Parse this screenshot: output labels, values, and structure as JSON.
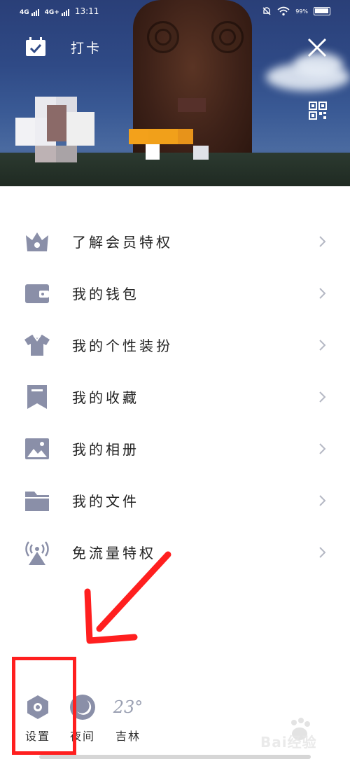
{
  "status_bar": {
    "network_1": "4G",
    "network_2": "4G+",
    "time": "13:11",
    "battery": "99%"
  },
  "header": {
    "checkin_label": "打卡",
    "checkin_icon": "calendar-check-icon",
    "close_icon": "close-icon",
    "qr_icon": "qr-code-icon"
  },
  "menu": {
    "items": [
      {
        "label": "了解会员特权",
        "icon": "crown-icon"
      },
      {
        "label": "我的钱包",
        "icon": "wallet-icon"
      },
      {
        "label": "我的个性装扮",
        "icon": "tshirt-icon"
      },
      {
        "label": "我的收藏",
        "icon": "bookmark-icon"
      },
      {
        "label": "我的相册",
        "icon": "photo-icon"
      },
      {
        "label": "我的文件",
        "icon": "folder-icon"
      },
      {
        "label": "免流量特权",
        "icon": "broadcast-tower-icon"
      }
    ]
  },
  "bottom_bar": {
    "settings_label": "设置",
    "night_label": "夜间",
    "weather_label": "吉林",
    "temperature": "23°"
  },
  "watermark": {
    "text": "Bai经验"
  },
  "colors": {
    "icon_gray": "#8a8fa8",
    "annotation_red": "#ff1f1f",
    "header_blue": "#2f4a86"
  }
}
